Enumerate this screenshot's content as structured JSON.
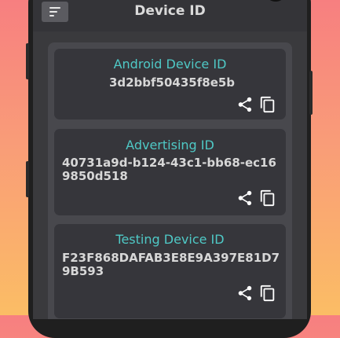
{
  "app": {
    "title": "Device ID"
  },
  "header": {
    "menu_icon": "sort-menu-icon"
  },
  "cards": [
    {
      "label": "Android Device ID",
      "value": "3d2bbf50435f8e5b",
      "share_icon": "share-icon",
      "copy_icon": "copy-icon"
    },
    {
      "label": "Advertising ID",
      "value": "40731a9d-b124-43c1-bb68-ec169850d518",
      "share_icon": "share-icon",
      "copy_icon": "copy-icon"
    },
    {
      "label": "Testing Device ID",
      "value": "F23F868DAFAB3E8E9A397E81D79B593",
      "share_icon": "share-icon",
      "copy_icon": "copy-icon"
    }
  ],
  "colors": {
    "accent": "#4fc9c6",
    "card": "#36363b",
    "panel": "#48484d",
    "topbar": "#343438"
  }
}
